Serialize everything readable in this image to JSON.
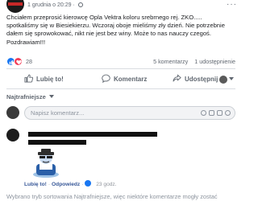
{
  "post": {
    "page_avatar_text": "SPOTTED",
    "meta": "1 grudnia o 20:29 ·",
    "text": "Chciałem przeprosić kierowcę Opla Vektra koloru srebrnego rej. ZKO..... spotkaliśmy się w Biesiekierzu. Wczoraj oboje mieliśmy zły dzień. Nie potrzebnie dałem się sprowokować, nikt nie jest bez winy. Może to nas nauczy czegoś. Pozdrawiam!!!"
  },
  "stats": {
    "reactions_count": "28",
    "comments": "5 komentarzy",
    "shares": "1 udostępnienie"
  },
  "actions": {
    "like": "Lubię to!",
    "comment": "Komentarz",
    "share": "Udostępnij"
  },
  "comments_section": {
    "sort_label": "Najtrafniejsze",
    "composer_placeholder": "Napisz komentarz...",
    "comment": {
      "like_label": "Lubię to!",
      "reply_label": "Odpowiedz",
      "time": "23 godz."
    },
    "footnote": "Wybrano tryb sortowania Najtrafniejsze, więc niektóre komentarze mogły zostać"
  },
  "colors": {
    "like_blue": "#1877f2",
    "love_red": "#f33e58",
    "muted": "#606770"
  }
}
